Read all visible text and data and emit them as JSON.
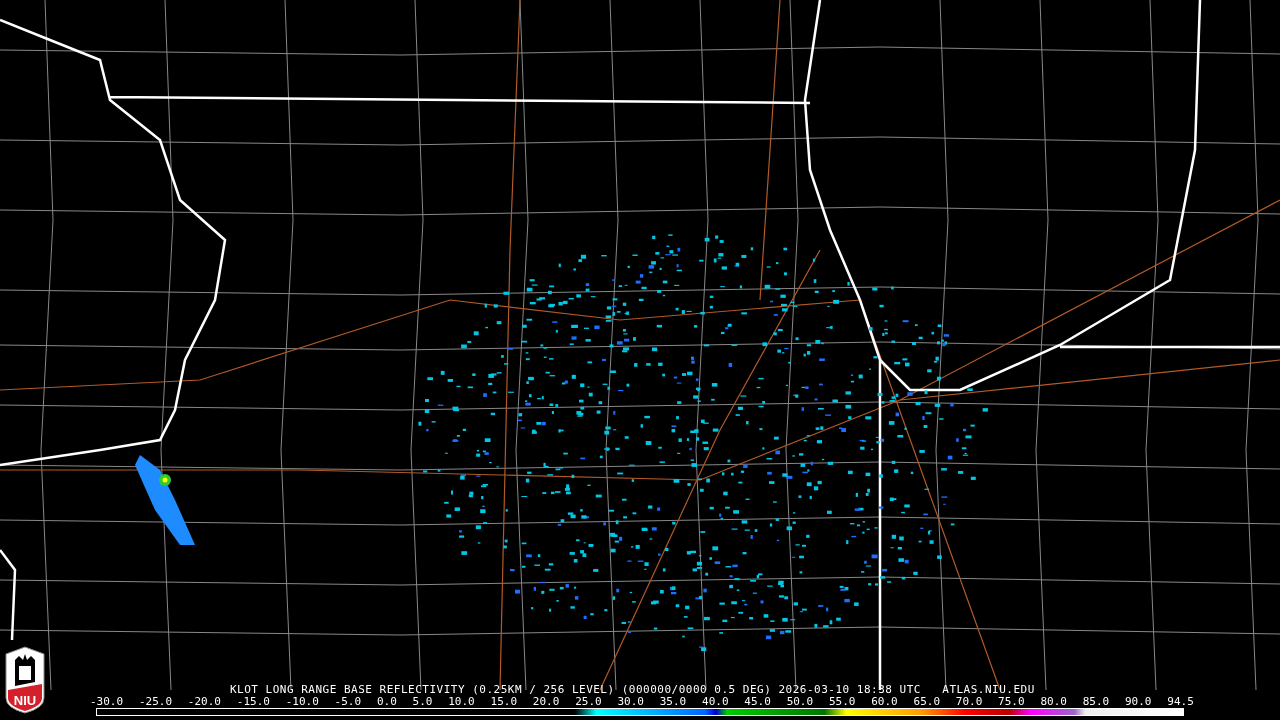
{
  "logo": {
    "text": "NIU"
  },
  "title": "KLOT LONG RANGE BASE REFLECTIVITY (0.25KM / 256 LEVEL) (000000/0000 0.5 DEG) 2026-03-10 18:38 UTC   ATLAS.NIU.EDU",
  "legend": {
    "labels": [
      "-30.0",
      "-25.0",
      "-20.0",
      "-15.0",
      "-10.0",
      "-5.0",
      "0.0",
      "5.0",
      "10.0",
      "15.0",
      "20.0",
      "25.0",
      "30.0",
      "35.0",
      "40.0",
      "45.0",
      "50.0",
      "55.0",
      "60.0",
      "65.0",
      "70.0",
      "75.0",
      "80.0",
      "85.0",
      "90.0",
      "94.5"
    ]
  }
}
